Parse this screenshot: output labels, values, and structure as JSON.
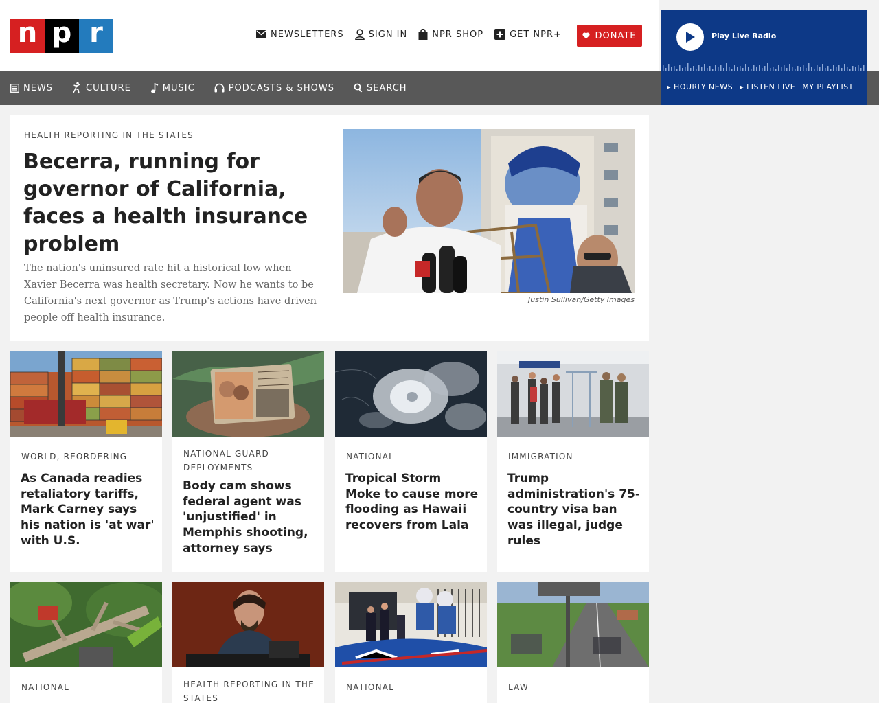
{
  "brand": {
    "n": "n",
    "p": "p",
    "r": "r"
  },
  "utility": [
    {
      "label": "NEWSLETTERS",
      "icon": "mail-icon"
    },
    {
      "label": "SIGN IN",
      "icon": "user-icon"
    },
    {
      "label": "NPR SHOP",
      "icon": "shopping-bag-icon"
    },
    {
      "label": "GET NPR+",
      "icon": "plus-square-icon"
    }
  ],
  "donate_label": "DONATE",
  "nav": [
    {
      "label": "NEWS",
      "icon": "news-icon"
    },
    {
      "label": "CULTURE",
      "icon": "culture-icon"
    },
    {
      "label": "MUSIC",
      "icon": "music-note-icon"
    },
    {
      "label": "PODCASTS & SHOWS",
      "icon": "headphones-icon"
    },
    {
      "label": "SEARCH",
      "icon": "search-icon"
    }
  ],
  "player": {
    "label": "Play Live Radio",
    "links": [
      "HOURLY NEWS",
      "LISTEN LIVE",
      "MY PLAYLIST"
    ]
  },
  "featured": {
    "slug": "HEALTH REPORTING IN THE STATES",
    "title": "Becerra, running for governor of California, faces a health insurance problem",
    "teaser": "The nation's uninsured rate hit a historical low when Xavier Becerra was health secretary. Now he wants to be California's next governor as Trump's actions have driven people off health insurance.",
    "credit": "Justin Sullivan/Getty Images"
  },
  "cards_row1": [
    {
      "slug": "WORLD, REORDERING",
      "title": "As Canada readies retaliatory tariffs, Mark Carney says his nation is 'at war' with U.S."
    },
    {
      "slug": "NATIONAL GUARD DEPLOYMENTS",
      "title": "Body cam shows federal agent was 'unjustified' in Memphis shooting, attorney says"
    },
    {
      "slug": "NATIONAL",
      "title": "Tropical Storm Moke to cause more flooding as Hawaii recovers from Lala"
    },
    {
      "slug": "IMMIGRATION",
      "title": "Trump administration's 75-country visa ban was illegal, judge rules"
    }
  ],
  "cards_row2": [
    {
      "slug": "NATIONAL"
    },
    {
      "slug": "HEALTH REPORTING IN THE STATES"
    },
    {
      "slug": "NATIONAL"
    },
    {
      "slug": "LAW"
    }
  ],
  "colors": {
    "npr_red": "#d62021",
    "npr_blue": "#237bbd",
    "player_blue": "#0d3987",
    "nav_gray": "#585858"
  }
}
